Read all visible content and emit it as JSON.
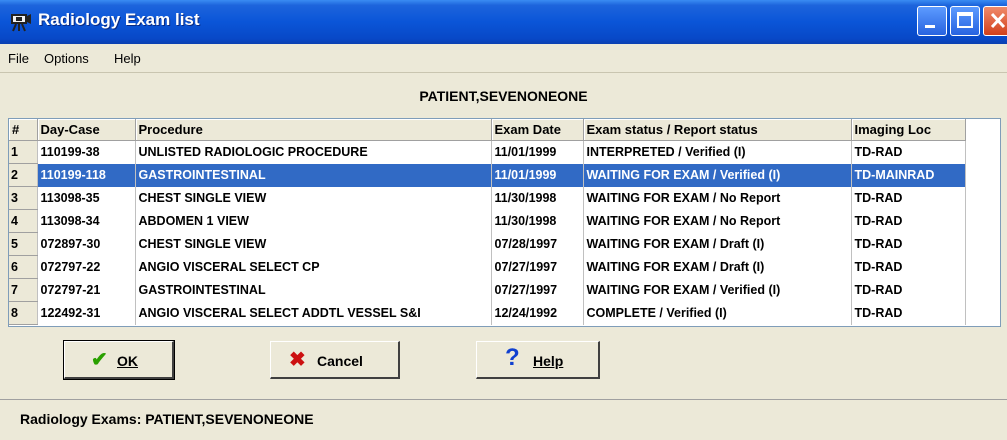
{
  "window": {
    "title": "Radiology Exam list"
  },
  "menu": {
    "items": [
      "File",
      "Options",
      "Help"
    ]
  },
  "patient": {
    "name": "PATIENT,SEVENONEONE"
  },
  "table": {
    "columns": [
      "#",
      "Day-Case",
      "Procedure",
      "Exam Date",
      "Exam status  / Report status",
      "Imaging Loc"
    ],
    "rows": [
      {
        "n": "1",
        "day_case": "110199-38",
        "procedure": "UNLISTED RADIOLOGIC PROCEDURE",
        "date": "11/01/1999",
        "status": "INTERPRETED  /  Verified (I)",
        "loc": "TD-RAD",
        "selected": false
      },
      {
        "n": "2",
        "day_case": "110199-118",
        "procedure": "GASTROINTESTINAL",
        "date": "11/01/1999",
        "status": "WAITING FOR EXAM  /  Verified (I)",
        "loc": "TD-MAINRAD",
        "selected": true
      },
      {
        "n": "3",
        "day_case": "113098-35",
        "procedure": "CHEST SINGLE VIEW",
        "date": "11/30/1998",
        "status": "WAITING FOR EXAM  /  No Report",
        "loc": "TD-RAD",
        "selected": false
      },
      {
        "n": "4",
        "day_case": "113098-34",
        "procedure": "ABDOMEN 1 VIEW",
        "date": "11/30/1998",
        "status": "WAITING FOR EXAM  /  No Report",
        "loc": "TD-RAD",
        "selected": false
      },
      {
        "n": "5",
        "day_case": "072897-30",
        "procedure": "CHEST SINGLE VIEW",
        "date": "07/28/1997",
        "status": "WAITING FOR EXAM  /  Draft (I)",
        "loc": "TD-RAD",
        "selected": false
      },
      {
        "n": "6",
        "day_case": "072797-22",
        "procedure": "ANGIO VISCERAL SELECT CP",
        "date": "07/27/1997",
        "status": "WAITING FOR EXAM  /  Draft (I)",
        "loc": "TD-RAD",
        "selected": false
      },
      {
        "n": "7",
        "day_case": "072797-21",
        "procedure": "GASTROINTESTINAL",
        "date": "07/27/1997",
        "status": "WAITING FOR EXAM  /  Verified (I)",
        "loc": "TD-RAD",
        "selected": false
      },
      {
        "n": "8",
        "day_case": "122492-31",
        "procedure": "ANGIO VISCERAL SELECT ADDTL VESSEL S&I",
        "date": "12/24/1992",
        "status": "COMPLETE  /  Verified (I)",
        "loc": "TD-RAD",
        "selected": false
      }
    ]
  },
  "buttons": {
    "ok": {
      "label": "OK",
      "icon": "checkmark-icon",
      "color": "#2aa000"
    },
    "cancel": {
      "label": "Cancel",
      "icon": "red-x-icon",
      "color": "#cc1010"
    },
    "help": {
      "label": "Help",
      "icon": "question-mark-icon",
      "color": "#1040d0"
    }
  },
  "status_bar": {
    "text": "Radiology Exams: PATIENT,SEVENONEONE"
  },
  "colors": {
    "titlebar": "#0a55d8",
    "selection": "#316ac5",
    "face": "#ece9d8"
  }
}
